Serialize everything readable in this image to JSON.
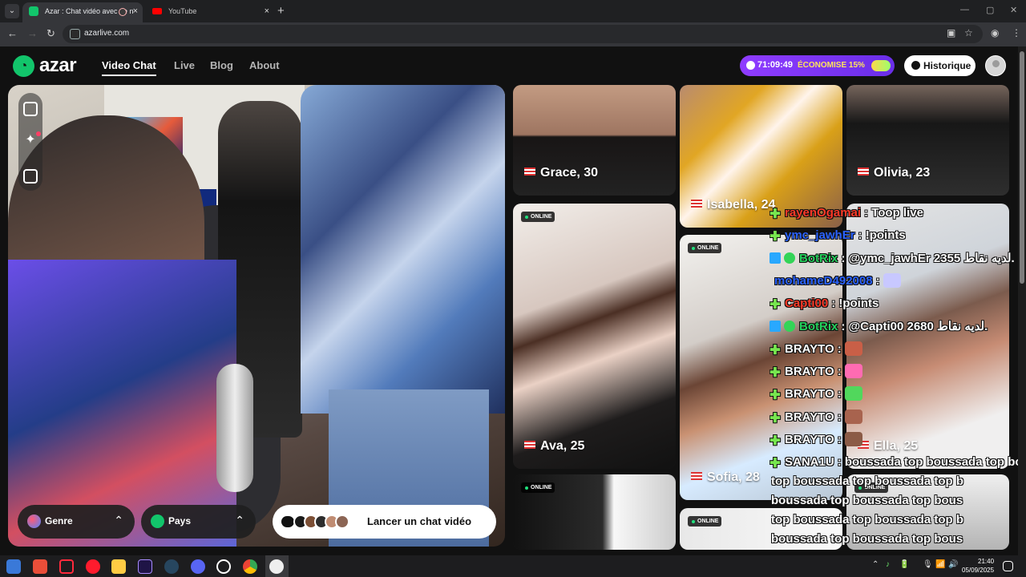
{
  "browser": {
    "tabs": [
      {
        "label": "Azar : Chat vidéo avec de n",
        "close": "×"
      },
      {
        "label": "YouTube",
        "close": "×"
      }
    ],
    "new_tab": "+",
    "tab_menu": "⌄",
    "url": "azarlive.com",
    "window_controls": [
      "—",
      "▢",
      "✕"
    ],
    "nav_controls": [
      "←",
      "→",
      "↻"
    ]
  },
  "site": {
    "logo": "azar",
    "nav": [
      "Video Chat",
      "Live",
      "Blog",
      "About"
    ],
    "promo": {
      "time": "71:09:49",
      "save": "ÉCONOMISE 15%"
    },
    "history": "Historique",
    "controls": {
      "genre": "Genre",
      "pays": "Pays",
      "cta": "Lancer un chat vidéo",
      "chevron": "⌃"
    }
  },
  "profiles": [
    {
      "name": "Grace, 30"
    },
    {
      "name": "Isabella, 24"
    },
    {
      "name": "Olivia, 23"
    },
    {
      "name": "Ava, 25",
      "status": "ONLINE"
    },
    {
      "name": "Sofia, 28",
      "status": "ONLINE"
    },
    {
      "name": "Ella, 25"
    },
    {
      "status": "ONLINE"
    },
    {
      "status": "ONLINE"
    },
    {
      "status": "ONLINE"
    }
  ],
  "chat": [
    {
      "user": "rayenOgamai",
      "text": ": Toop live",
      "user_color": "#ff3a28"
    },
    {
      "user": "ymc_jawhEr",
      "text": ": !points",
      "user_color": "#2a62ff"
    },
    {
      "user": "BotRix",
      "text": ": @ymc_jawhEr 2355 لديه نقاط.",
      "user_color": "#26d05d"
    },
    {
      "user": "mohameD492008",
      "text": ":",
      "user_color": "#2a62ff"
    },
    {
      "user": "Capti00",
      "text": ": !points",
      "user_color": "#ff3a28"
    },
    {
      "user": "BotRix",
      "text": ": @Capti00 2680 لديه نقاط.",
      "user_color": "#26d05d"
    },
    {
      "user": "BRAYTO",
      "text": ":",
      "user_color": "#ffffff"
    },
    {
      "user": "BRAYTO",
      "text": ":",
      "user_color": "#ffffff"
    },
    {
      "user": "BRAYTO",
      "text": ":",
      "user_color": "#ffffff"
    },
    {
      "user": "BRAYTO",
      "text": ":",
      "user_color": "#ffffff"
    },
    {
      "user": "BRAYTO",
      "text": ":",
      "user_color": "#ffffff"
    },
    {
      "user": "SANA1U",
      "text": ": boussada top boussada top bo",
      "user_color": "#ffffff"
    },
    {
      "user": "",
      "text": "top boussada top boussada top b",
      "user_color": "#ffffff"
    },
    {
      "user": "",
      "text": "boussada top boussada top bous",
      "user_color": "#ffffff"
    },
    {
      "user": "",
      "text": "top boussada top boussada top b",
      "user_color": "#ffffff"
    },
    {
      "user": "",
      "text": "boussada top boussada top bous",
      "user_color": "#ffffff"
    }
  ],
  "taskbar": {
    "time": "21:40",
    "date": "05/09/2025",
    "tray": [
      "⌃",
      "♪",
      "🔋",
      "🎙",
      "📶",
      "🔊"
    ]
  },
  "colors": {
    "azar_green": "#12c56b",
    "promo_purple": "#7b35f0",
    "promo_yellow": "#ffe45c"
  },
  "icons": {
    "expand": "expand-icon",
    "sparkle": "sparkle-icon",
    "smile": "smile-icon",
    "clock": "clock-icon",
    "user": "user-icon",
    "chat": "chat-icon"
  }
}
